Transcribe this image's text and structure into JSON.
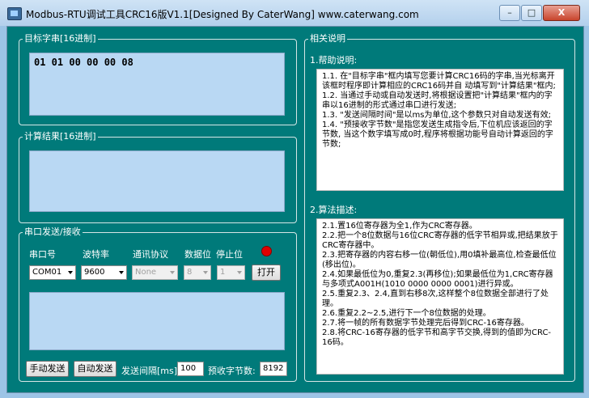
{
  "window": {
    "title": "Modbus-RTU调试工具CRC16版V1.1[Designed By CaterWang]     www.caterwang.com",
    "minimize": "–",
    "maximize": "□",
    "close": "X"
  },
  "target": {
    "group_title": "目标字串[16进制]",
    "value": "01 01 00 00 00 08"
  },
  "result": {
    "group_title": "计算结果[16进制]",
    "value": ""
  },
  "serial": {
    "group_title": "串口发送/接收",
    "port_label": "串口号",
    "baud_label": "波特率",
    "protocol_label": "通讯协议",
    "databits_label": "数据位",
    "stopbits_label": "停止位",
    "port_value": "COM01",
    "baud_value": "9600",
    "protocol_value": "None",
    "databits_value": "8",
    "stopbits_value": "1",
    "open_button": "打开",
    "status_color": "#e00000",
    "receive_text": "",
    "manual_send": "手动发送",
    "auto_send": "自动发送",
    "interval_label": "发送间隔[ms]",
    "interval_value": "100",
    "expect_label": "预收字节数:",
    "expect_value": "8192"
  },
  "help": {
    "group_title": "相关说明",
    "help_title": "1.帮助说明:",
    "help_lines": [
      "1.1. 在\"目标字串\"框内填写您要计算CRC16码的字串,当光标离开该框时程序即计算相应的CRC16码并自 动填写到\"计算结果\"框内;",
      "1.2. 当通过手动或自动发送时,将根据设置把\"计算结果\"框内的字串以16进制的形式通过串口进行发送;",
      "1.3. \"发送间隔时间\"是以ms为单位,这个参数只对自动发送有效;",
      "1.4. \"预接收字节数\"是指您发送生成指令后,下位机应该返回的字节数, 当这个数字填写成0时,程序将根据功能号自动计算返回的字节数;"
    ],
    "algo_title": "2.算法描述:",
    "algo_lines": [
      "2.1.置16位寄存器为全1,作为CRC寄存器。",
      "2.2.把一个8位数据与16位CRC寄存器的低字节相异或,把结果放于CRC寄存器中。",
      "2.3.把寄存器的内容右移一位(朝低位),用0填补最高位,检查最低位(移出位)。",
      "2.4.如果最低位为0,重复2.3(再移位);如果最低位为1,CRC寄存器与多项式A001H(1010 0000 0000 0001)进行异或。",
      "2.5.重复2.3、2.4,直到右移8次,这样整个8位数据全部进行了处理。",
      "2.6.重复2.2~2.5,进行下一个8位数据的处理。",
      "2.7.将一帧的所有数据字节处理完后得到CRC-16寄存器。",
      "2.8.将CRC-16寄存器的低字节和高字节交换,得到的值即为CRC-16码。"
    ]
  }
}
